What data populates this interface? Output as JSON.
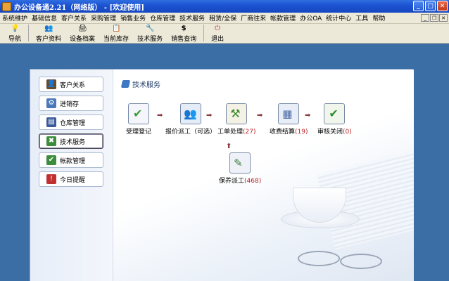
{
  "window": {
    "title": "办公设备通2.21（网络版） - [欢迎使用]",
    "minimize": "_",
    "maximize": "□",
    "close": "✕"
  },
  "menu": [
    "系统维护",
    "基础信息",
    "客户关系",
    "采购管理",
    "销售业务",
    "仓库管理",
    "技术服务",
    "租赁/全保",
    "厂商往来",
    "帐款管理",
    "办公OA",
    "统计中心",
    "工具",
    "帮助"
  ],
  "toolbar": [
    {
      "label": "导航",
      "icon": "bulb-icon",
      "glyph": "💡"
    },
    {
      "label": "客户资料",
      "icon": "users-icon",
      "glyph": "👥"
    },
    {
      "label": "设备档案",
      "icon": "device-icon",
      "glyph": "🖨"
    },
    {
      "label": "当前库存",
      "icon": "stock-icon",
      "glyph": "📋"
    },
    {
      "label": "技术服务",
      "icon": "tools-icon",
      "glyph": "🔧"
    },
    {
      "label": "销售查询",
      "icon": "dollar-icon",
      "glyph": "$"
    },
    {
      "label": "退出",
      "icon": "exit-icon",
      "glyph": "⏻"
    }
  ],
  "sidebar": [
    {
      "label": "客户关系",
      "icon": "customer-icon",
      "color": "#6b4a2a",
      "glyph": "👤"
    },
    {
      "label": "进销存",
      "icon": "inventory-icon",
      "color": "#4a78b8",
      "glyph": "⚙"
    },
    {
      "label": "仓库管理",
      "icon": "warehouse-icon",
      "color": "#3a5a9a",
      "glyph": "▤"
    },
    {
      "label": "技术服务",
      "icon": "service-icon",
      "color": "#3c8c3c",
      "glyph": "✖"
    },
    {
      "label": "帐款管理",
      "icon": "account-icon",
      "color": "#3c8c3c",
      "glyph": "✔"
    },
    {
      "label": "今日提醒",
      "icon": "reminder-icon",
      "color": "#c03030",
      "glyph": "!"
    }
  ],
  "section_title": "技术服务",
  "flow": [
    {
      "label": "受理登记",
      "count": "",
      "icon": "register-icon"
    },
    {
      "label": "报价派工（可选）",
      "count": "",
      "icon": "quote-dispatch-icon"
    },
    {
      "label": "工单处理",
      "count": "(27)",
      "icon": "workorder-icon"
    },
    {
      "label": "收费结算",
      "count": "(19)",
      "icon": "billing-icon"
    },
    {
      "label": "审核关闭",
      "count": "(0)",
      "icon": "audit-close-icon"
    }
  ],
  "maintenance": {
    "label": "保养派工",
    "count": "(468)",
    "icon": "maintenance-icon"
  },
  "colors": {
    "titlebar": "#1d54d2",
    "desktop": "#3a6ea5",
    "menubar": "#ece9d8",
    "count": "#bb2222"
  }
}
